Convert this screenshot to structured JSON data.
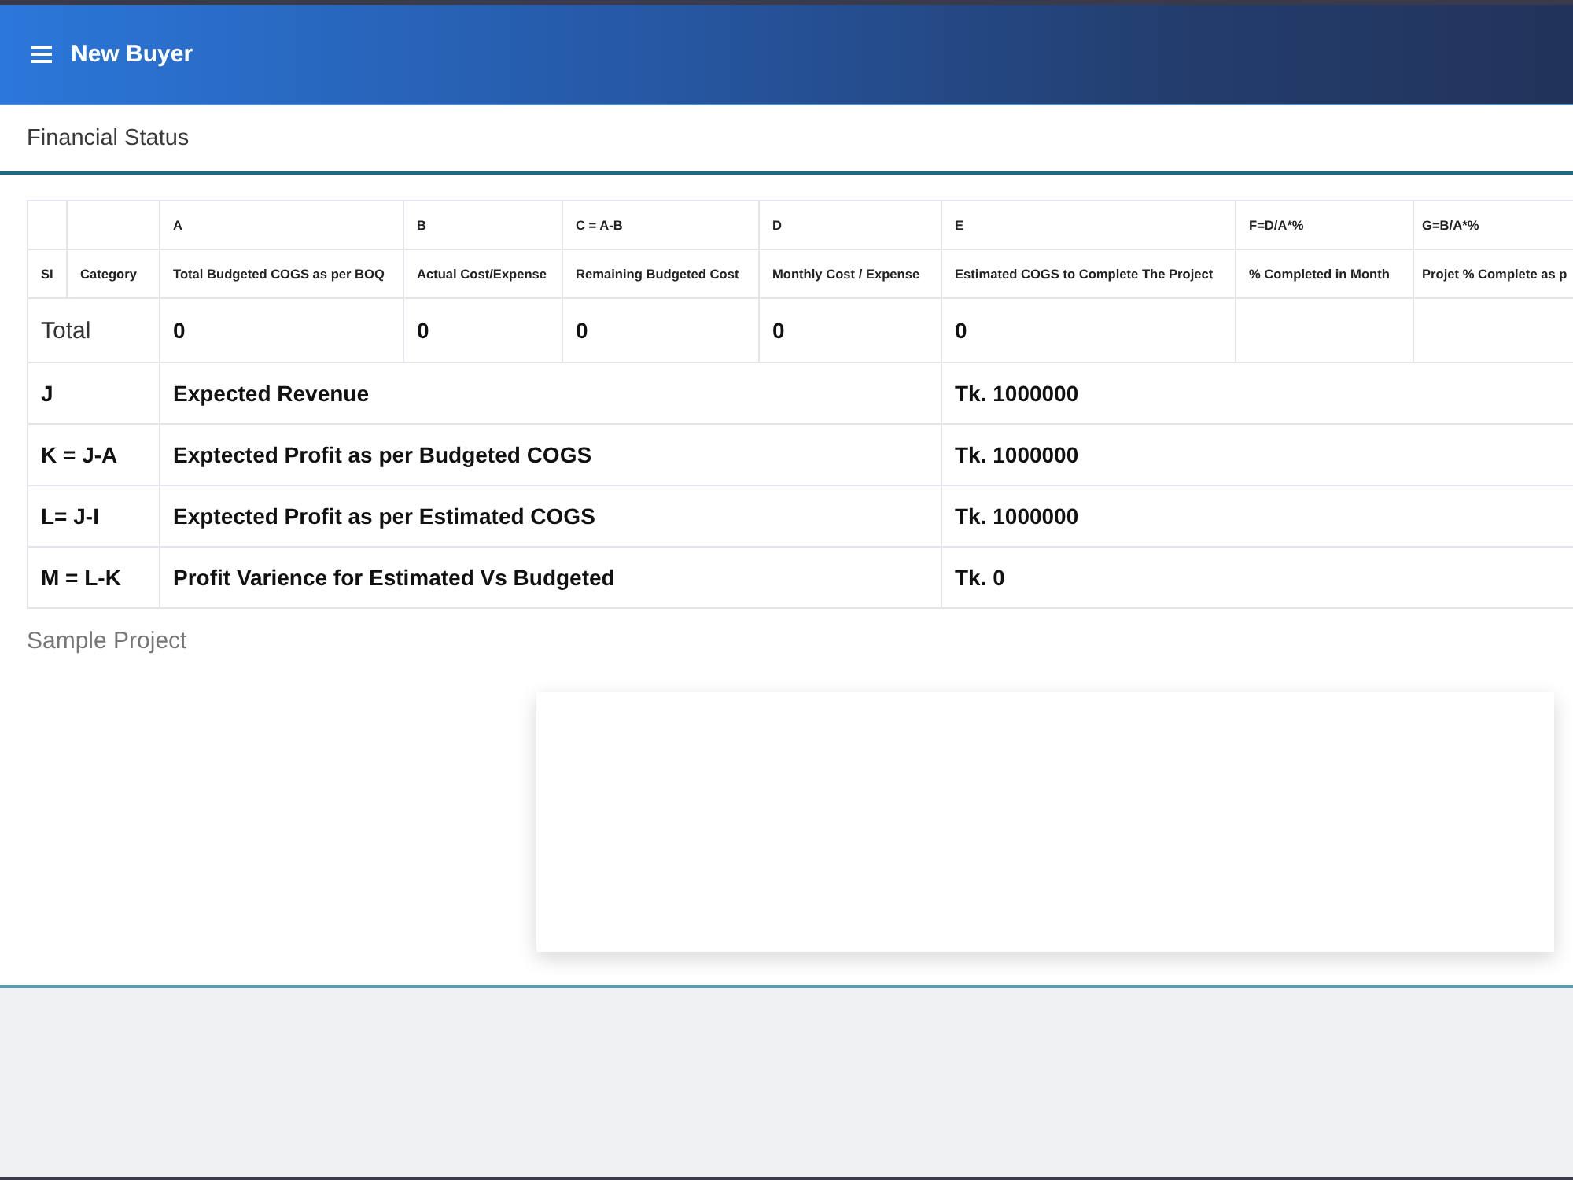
{
  "header": {
    "title": "New Buyer"
  },
  "section": {
    "title": "Financial Status"
  },
  "table": {
    "columns": [
      {
        "name": "SI"
      },
      {
        "name": "Category"
      },
      {
        "formula": "A",
        "name": "Total Budgeted COGS as per BOQ"
      },
      {
        "formula": "B",
        "name": "Actual Cost/Expense"
      },
      {
        "formula": "C = A-B",
        "name": "Remaining Budgeted Cost"
      },
      {
        "formula": "D",
        "name": "Monthly Cost / Expense"
      },
      {
        "formula": "E",
        "name": "Estimated COGS to Complete The Project"
      },
      {
        "formula": "F=D/A*%",
        "name": "% Completed in Month"
      },
      {
        "formula": "G=B/A*%",
        "name": "Projet % Complete as p"
      }
    ],
    "total_row": {
      "label": "Total",
      "values": [
        "0",
        "0",
        "0",
        "0",
        "0"
      ]
    },
    "summary_rows": [
      {
        "code": "J",
        "description": "Expected Revenue",
        "amount": "Tk. 1000000"
      },
      {
        "code": "K = J-A",
        "description": "Exptected Profit as per Budgeted COGS",
        "amount": "Tk. 1000000"
      },
      {
        "code": "L= J-I",
        "description": "Exptected Profit as per Estimated COGS",
        "amount": "Tk. 1000000"
      },
      {
        "code": "M = L-K",
        "description": "Profit Varience for Estimated Vs Budgeted",
        "amount": "Tk. 0"
      }
    ]
  },
  "project": {
    "name": "Sample Project"
  }
}
